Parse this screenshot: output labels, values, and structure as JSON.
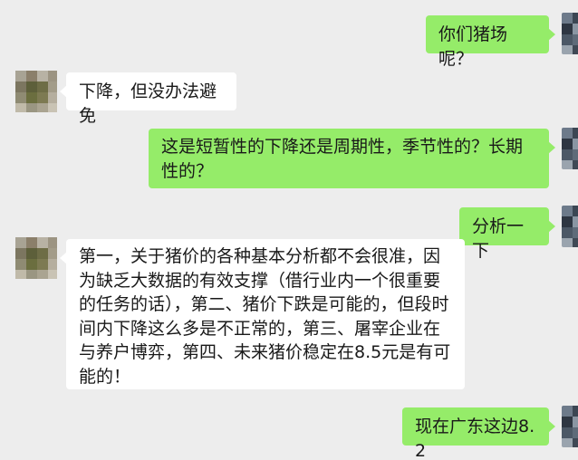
{
  "conversation": {
    "messages": [
      {
        "sender": "me",
        "text": "你们猪场呢？"
      },
      {
        "sender": "contact",
        "text": "下降，但没办法避免"
      },
      {
        "sender": "me",
        "text": "这是短暂性的下降还是周期性，季节性的？长期性的？"
      },
      {
        "sender": "me",
        "text": "分析一下"
      },
      {
        "sender": "contact",
        "text": "第一，关于猪价的各种基本分析都不会很准，因为缺乏大数据的有效支撑（借行业内一个很重要的任务的话），第二、猪价下跌是可能的，但段时间内下降这么多是不正常的，第三、屠宰企业在与养户博弈，第四、未来猪价稳定在8.5元是有可能的！"
      },
      {
        "sender": "me",
        "text": "现在广东这边8.2"
      }
    ]
  },
  "theme": {
    "background": "#ededed",
    "outgoing_bubble": "#95ec69",
    "incoming_bubble": "#ffffff",
    "text_color": "#191919"
  }
}
